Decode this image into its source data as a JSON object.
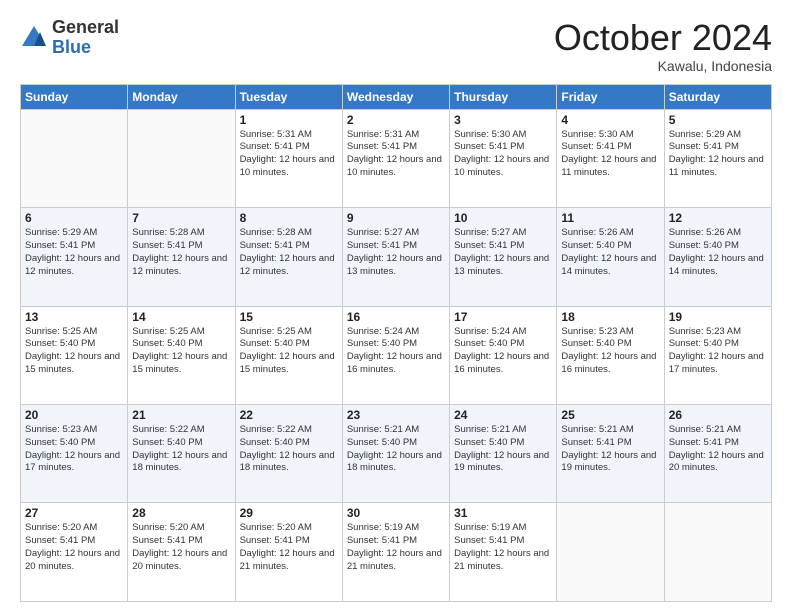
{
  "logo": {
    "general": "General",
    "blue": "Blue"
  },
  "header": {
    "month": "October 2024",
    "location": "Kawalu, Indonesia"
  },
  "days_of_week": [
    "Sunday",
    "Monday",
    "Tuesday",
    "Wednesday",
    "Thursday",
    "Friday",
    "Saturday"
  ],
  "weeks": [
    [
      null,
      null,
      {
        "num": "1",
        "sunrise": "Sunrise: 5:31 AM",
        "sunset": "Sunset: 5:41 PM",
        "daylight": "Daylight: 12 hours and 10 minutes."
      },
      {
        "num": "2",
        "sunrise": "Sunrise: 5:31 AM",
        "sunset": "Sunset: 5:41 PM",
        "daylight": "Daylight: 12 hours and 10 minutes."
      },
      {
        "num": "3",
        "sunrise": "Sunrise: 5:30 AM",
        "sunset": "Sunset: 5:41 PM",
        "daylight": "Daylight: 12 hours and 10 minutes."
      },
      {
        "num": "4",
        "sunrise": "Sunrise: 5:30 AM",
        "sunset": "Sunset: 5:41 PM",
        "daylight": "Daylight: 12 hours and 11 minutes."
      },
      {
        "num": "5",
        "sunrise": "Sunrise: 5:29 AM",
        "sunset": "Sunset: 5:41 PM",
        "daylight": "Daylight: 12 hours and 11 minutes."
      }
    ],
    [
      {
        "num": "6",
        "sunrise": "Sunrise: 5:29 AM",
        "sunset": "Sunset: 5:41 PM",
        "daylight": "Daylight: 12 hours and 12 minutes."
      },
      {
        "num": "7",
        "sunrise": "Sunrise: 5:28 AM",
        "sunset": "Sunset: 5:41 PM",
        "daylight": "Daylight: 12 hours and 12 minutes."
      },
      {
        "num": "8",
        "sunrise": "Sunrise: 5:28 AM",
        "sunset": "Sunset: 5:41 PM",
        "daylight": "Daylight: 12 hours and 12 minutes."
      },
      {
        "num": "9",
        "sunrise": "Sunrise: 5:27 AM",
        "sunset": "Sunset: 5:41 PM",
        "daylight": "Daylight: 12 hours and 13 minutes."
      },
      {
        "num": "10",
        "sunrise": "Sunrise: 5:27 AM",
        "sunset": "Sunset: 5:41 PM",
        "daylight": "Daylight: 12 hours and 13 minutes."
      },
      {
        "num": "11",
        "sunrise": "Sunrise: 5:26 AM",
        "sunset": "Sunset: 5:40 PM",
        "daylight": "Daylight: 12 hours and 14 minutes."
      },
      {
        "num": "12",
        "sunrise": "Sunrise: 5:26 AM",
        "sunset": "Sunset: 5:40 PM",
        "daylight": "Daylight: 12 hours and 14 minutes."
      }
    ],
    [
      {
        "num": "13",
        "sunrise": "Sunrise: 5:25 AM",
        "sunset": "Sunset: 5:40 PM",
        "daylight": "Daylight: 12 hours and 15 minutes."
      },
      {
        "num": "14",
        "sunrise": "Sunrise: 5:25 AM",
        "sunset": "Sunset: 5:40 PM",
        "daylight": "Daylight: 12 hours and 15 minutes."
      },
      {
        "num": "15",
        "sunrise": "Sunrise: 5:25 AM",
        "sunset": "Sunset: 5:40 PM",
        "daylight": "Daylight: 12 hours and 15 minutes."
      },
      {
        "num": "16",
        "sunrise": "Sunrise: 5:24 AM",
        "sunset": "Sunset: 5:40 PM",
        "daylight": "Daylight: 12 hours and 16 minutes."
      },
      {
        "num": "17",
        "sunrise": "Sunrise: 5:24 AM",
        "sunset": "Sunset: 5:40 PM",
        "daylight": "Daylight: 12 hours and 16 minutes."
      },
      {
        "num": "18",
        "sunrise": "Sunrise: 5:23 AM",
        "sunset": "Sunset: 5:40 PM",
        "daylight": "Daylight: 12 hours and 16 minutes."
      },
      {
        "num": "19",
        "sunrise": "Sunrise: 5:23 AM",
        "sunset": "Sunset: 5:40 PM",
        "daylight": "Daylight: 12 hours and 17 minutes."
      }
    ],
    [
      {
        "num": "20",
        "sunrise": "Sunrise: 5:23 AM",
        "sunset": "Sunset: 5:40 PM",
        "daylight": "Daylight: 12 hours and 17 minutes."
      },
      {
        "num": "21",
        "sunrise": "Sunrise: 5:22 AM",
        "sunset": "Sunset: 5:40 PM",
        "daylight": "Daylight: 12 hours and 18 minutes."
      },
      {
        "num": "22",
        "sunrise": "Sunrise: 5:22 AM",
        "sunset": "Sunset: 5:40 PM",
        "daylight": "Daylight: 12 hours and 18 minutes."
      },
      {
        "num": "23",
        "sunrise": "Sunrise: 5:21 AM",
        "sunset": "Sunset: 5:40 PM",
        "daylight": "Daylight: 12 hours and 18 minutes."
      },
      {
        "num": "24",
        "sunrise": "Sunrise: 5:21 AM",
        "sunset": "Sunset: 5:40 PM",
        "daylight": "Daylight: 12 hours and 19 minutes."
      },
      {
        "num": "25",
        "sunrise": "Sunrise: 5:21 AM",
        "sunset": "Sunset: 5:41 PM",
        "daylight": "Daylight: 12 hours and 19 minutes."
      },
      {
        "num": "26",
        "sunrise": "Sunrise: 5:21 AM",
        "sunset": "Sunset: 5:41 PM",
        "daylight": "Daylight: 12 hours and 20 minutes."
      }
    ],
    [
      {
        "num": "27",
        "sunrise": "Sunrise: 5:20 AM",
        "sunset": "Sunset: 5:41 PM",
        "daylight": "Daylight: 12 hours and 20 minutes."
      },
      {
        "num": "28",
        "sunrise": "Sunrise: 5:20 AM",
        "sunset": "Sunset: 5:41 PM",
        "daylight": "Daylight: 12 hours and 20 minutes."
      },
      {
        "num": "29",
        "sunrise": "Sunrise: 5:20 AM",
        "sunset": "Sunset: 5:41 PM",
        "daylight": "Daylight: 12 hours and 21 minutes."
      },
      {
        "num": "30",
        "sunrise": "Sunrise: 5:19 AM",
        "sunset": "Sunset: 5:41 PM",
        "daylight": "Daylight: 12 hours and 21 minutes."
      },
      {
        "num": "31",
        "sunrise": "Sunrise: 5:19 AM",
        "sunset": "Sunset: 5:41 PM",
        "daylight": "Daylight: 12 hours and 21 minutes."
      },
      null,
      null
    ]
  ]
}
